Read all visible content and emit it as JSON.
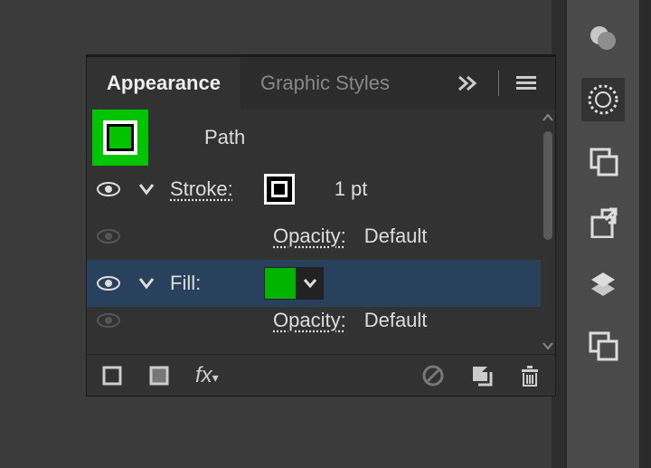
{
  "panel": {
    "tab1": "Appearance",
    "tab2": "Graphic Styles",
    "target_label": "Path",
    "stroke_label": "Stroke:",
    "stroke_weight": "1 pt",
    "opacity_label": "Opacity:",
    "opacity_value": "Default",
    "fill_label": "Fill:",
    "opacity2_label": "Opacity:",
    "opacity2_value": "Default",
    "fx_label": "fx"
  },
  "colors": {
    "fill": "#00b400",
    "highlight": "#00c400",
    "selection": "#29415c"
  },
  "toolbar_icons": [
    "color-guide-icon",
    "appearance-icon",
    "graphic-styles-icon",
    "link-icon",
    "layers-icon",
    "artboards-icon"
  ]
}
